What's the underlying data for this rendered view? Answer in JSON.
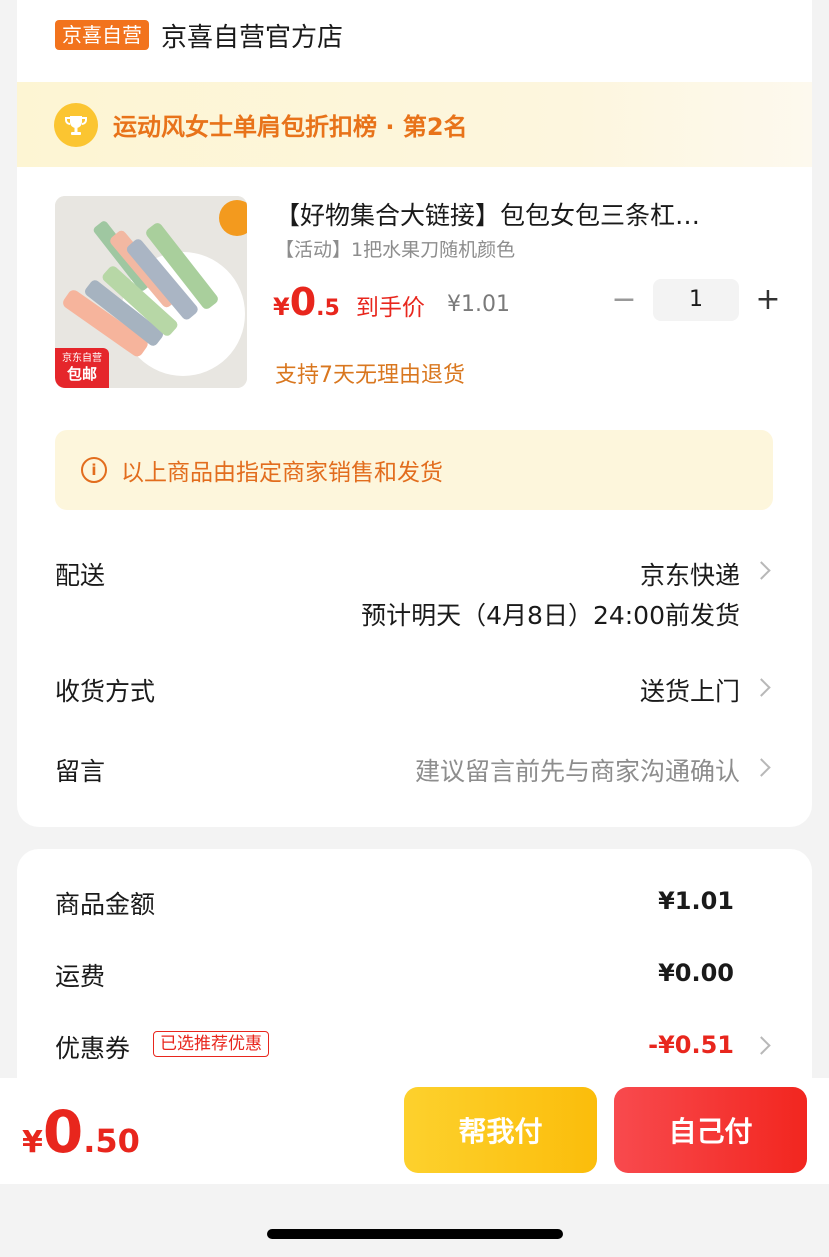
{
  "store": {
    "badge": "京喜自营",
    "name": "京喜自营官方店"
  },
  "rank_banner": {
    "icon": "trophy-icon",
    "text": "运动风女士单肩包折扣榜 · 第2名"
  },
  "product": {
    "title": "【好物集合大链接】包包女包三条杠…",
    "spec": "【活动】1把水果刀随机颜色",
    "price_symbol": "¥",
    "price_int": "0",
    "price_dec": ".5",
    "price_tag": "到手价",
    "original_price": "¥1.01",
    "quantity": "1",
    "minus_label": "−",
    "plus_label": "+",
    "return_policy": "支持7天无理由退货",
    "image_badge_top": "京东自营",
    "image_badge_bottom": "包邮"
  },
  "notice": {
    "icon": "info-icon",
    "text": "以上商品由指定商家销售和发货"
  },
  "delivery": {
    "label": "配送",
    "method": "京东快递",
    "eta": "预计明天（4月8日）24:00前发货"
  },
  "receive": {
    "label": "收货方式",
    "value": "送货上门"
  },
  "message": {
    "label": "留言",
    "placeholder": "建议留言前先与商家沟通确认"
  },
  "summary": {
    "goods_label": "商品金额",
    "goods_value": "¥1.01",
    "freight_label": "运费",
    "freight_value": "¥0.00",
    "coupon_label": "优惠券",
    "coupon_tag": "已选推荐优惠",
    "coupon_value": "-¥0.51"
  },
  "footer": {
    "total_symbol": "¥",
    "total_int": "0",
    "total_dec": ".50",
    "help_pay": "帮我付",
    "self_pay": "自己付"
  },
  "colors": {
    "accent_red": "#e8261d",
    "accent_orange": "#f2731d",
    "help_button": "#fbc41a",
    "pay_button": "#f4332e"
  }
}
